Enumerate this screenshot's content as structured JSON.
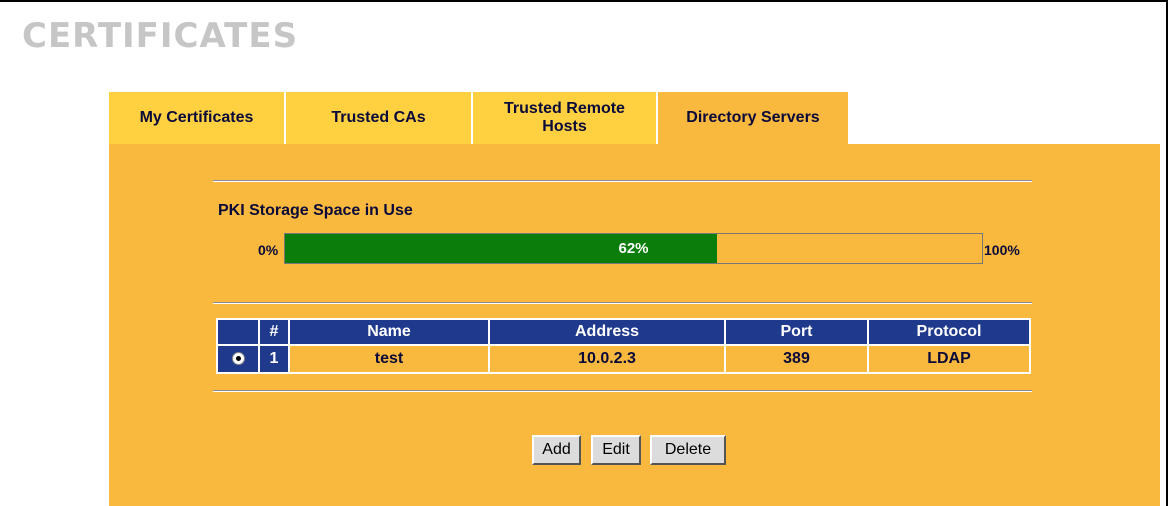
{
  "page": {
    "title": "CERTIFICATES"
  },
  "tabs": [
    {
      "label": "My Certificates",
      "active": false
    },
    {
      "label": "Trusted CAs",
      "active": false
    },
    {
      "label": "Trusted Remote Hosts",
      "active": false
    },
    {
      "label": "Directory Servers",
      "active": true
    }
  ],
  "storage": {
    "label": "PKI Storage Space in Use",
    "min_label": "0%",
    "max_label": "100%",
    "used_label": "62%",
    "used_fraction": 0.62,
    "fill_color": "#0a7d0a"
  },
  "table": {
    "columns": [
      "",
      "#",
      "Name",
      "Address",
      "Port",
      "Protocol"
    ],
    "rows": [
      {
        "selected": true,
        "index": "1",
        "name": "test",
        "address": "10.0.2.3",
        "port": "389",
        "protocol": "LDAP"
      }
    ]
  },
  "buttons": {
    "add": "Add",
    "edit": "Edit",
    "delete": "Delete"
  },
  "colors": {
    "panel": "#f9b83e",
    "tab": "#ffd040",
    "header": "#1f3a8c"
  }
}
